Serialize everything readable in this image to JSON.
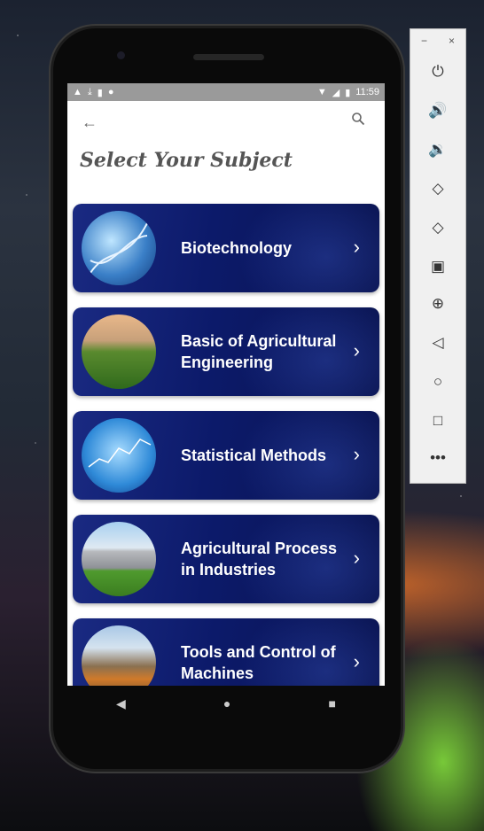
{
  "status_bar": {
    "time": "11:59",
    "left_icons": [
      "alert-icon",
      "download-icon",
      "sd-card-icon",
      "sync-icon"
    ]
  },
  "app": {
    "title": "Select Your Subject",
    "subjects": [
      {
        "label": "Biotechnology"
      },
      {
        "label": "Basic of Agricultural Engineering"
      },
      {
        "label": "Statistical Methods"
      },
      {
        "label": "Agricultural Process in Industries"
      },
      {
        "label": "Tools and Control of Machines"
      }
    ]
  },
  "emulator_toolbar": {
    "minimize": "−",
    "close": "×",
    "tools": [
      "power-icon",
      "volume-up-icon",
      "volume-down-icon",
      "rotate-left-icon",
      "rotate-right-icon",
      "camera-icon",
      "zoom-icon",
      "back-icon",
      "home-icon",
      "overview-icon",
      "more-icon"
    ]
  },
  "colors": {
    "card_start": "#1a2a82",
    "card_end": "#0a1450",
    "title": "#555555"
  }
}
